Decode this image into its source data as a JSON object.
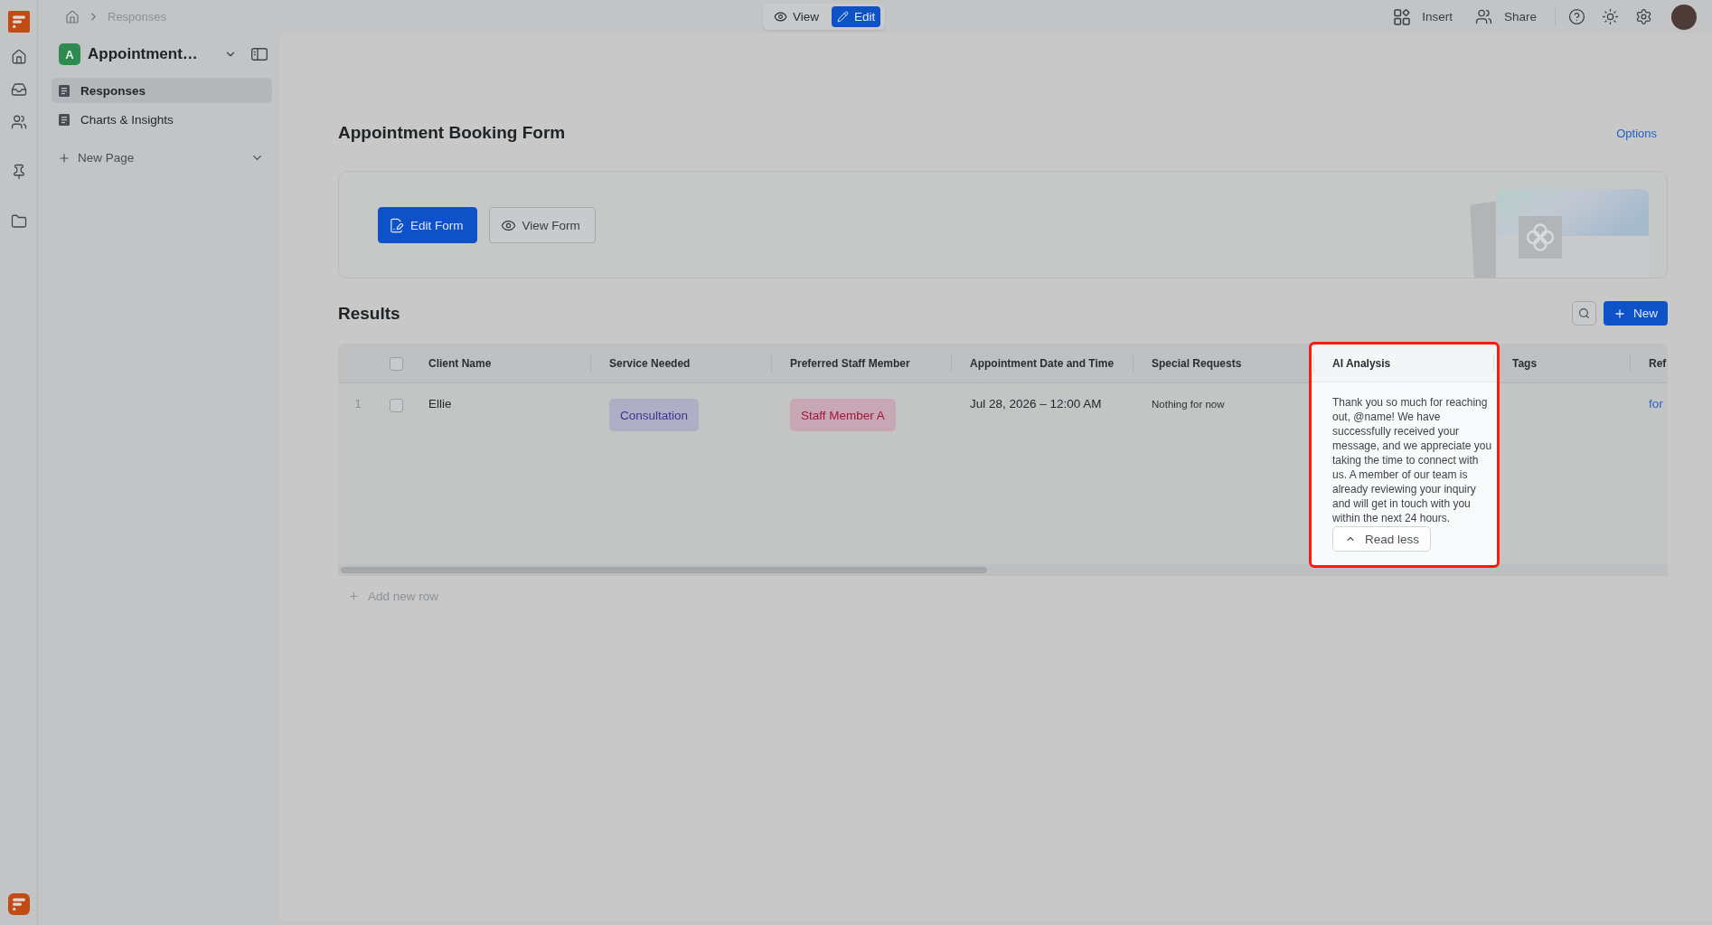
{
  "topbar": {
    "breadcrumb": [
      "Responses"
    ],
    "modes": [
      {
        "kind": "view",
        "label": "View",
        "selected": false
      },
      {
        "kind": "edit",
        "label": "Edit",
        "selected": true
      }
    ],
    "actions": [
      {
        "kind": "insert",
        "label": "Insert"
      },
      {
        "kind": "share",
        "label": "Share"
      }
    ]
  },
  "sidebar": {
    "workspace": {
      "initial": "A",
      "name": "Appointment…"
    },
    "pages": [
      {
        "label": "Responses",
        "selected": true
      },
      {
        "label": "Charts & Insights",
        "selected": false
      }
    ],
    "new_page": "New Page"
  },
  "form": {
    "title": "Appointment Booking Form",
    "options": "Options",
    "buttons": [
      {
        "kind": "edit",
        "label": "Edit Form"
      },
      {
        "kind": "view",
        "label": "View Form"
      }
    ]
  },
  "results": {
    "title": "Results",
    "new_button": "New",
    "table": {
      "select_all_checked": false,
      "columns": [
        {
          "label": "Client Name",
          "highlighted": false
        },
        {
          "label": "Service Needed",
          "highlighted": false
        },
        {
          "label": "Preferred Staff Member",
          "highlighted": false
        },
        {
          "label": "Appointment Date and Time",
          "highlighted": false
        },
        {
          "label": "Special Requests",
          "highlighted": false
        },
        {
          "label": "AI Analysis",
          "highlighted": true
        },
        {
          "label": "Tags",
          "highlighted": false
        },
        {
          "label": "Ref",
          "highlighted": false
        }
      ],
      "rows": [
        {
          "number": "1",
          "checked": false,
          "cells": [
            {
              "kind": "text",
              "value": "Ellie"
            },
            {
              "kind": "tag",
              "value": "Consultation",
              "color": "#3d3592"
            },
            {
              "kind": "tag",
              "value": "Staff Member A",
              "color": "#a1163e"
            },
            {
              "kind": "text",
              "value": "Jul 28, 2026 – 12:00 AM"
            },
            {
              "kind": "note",
              "value": "Nothing for now"
            },
            {
              "kind": "long_text",
              "value": "Thank you so much for reaching out, @name! We have successfully received your message, and we appreciate you taking the time to connect with us. A member of our team is already reviewing your inquiry and will get in touch with you within the next 24 hours.",
              "toggle": {
                "label": "Read less",
                "expanded": true
              }
            },
            {
              "kind": "empty"
            },
            {
              "kind": "link",
              "value": "for"
            }
          ]
        }
      ]
    },
    "add_row": "Add new row"
  }
}
